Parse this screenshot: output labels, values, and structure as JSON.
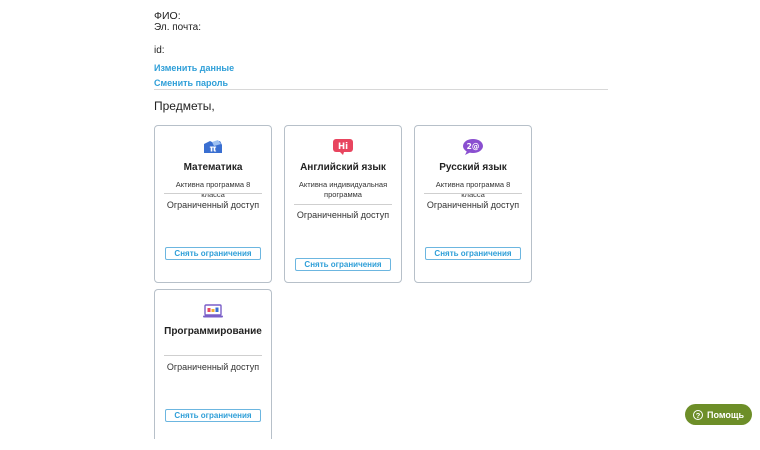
{
  "profile": {
    "fio_label": "ФИО:",
    "email_label": "Эл. почта:",
    "id_label": "id:",
    "edit_link": "Изменить данные",
    "password_link": "Сменить пароль"
  },
  "subjects_title": "Предметы,",
  "cards": [
    {
      "name": "Математика",
      "desc": "Активна программа 8 класса",
      "status": "Ограниченный доступ",
      "button": "Снять ограничения",
      "icon": "pi-math-icon"
    },
    {
      "name": "Английский язык",
      "desc": "Активна индивидуальная программа",
      "status": "Ограниченный доступ",
      "button": "Снять ограничения",
      "icon": "hi-speech-bubble-icon"
    },
    {
      "name": "Русский язык",
      "desc": "Активна программа 8 класса",
      "status": "Ограниченный доступ",
      "button": "Снять ограничения",
      "icon": "speech-bubble-icon"
    },
    {
      "name": "Программирование",
      "desc": "",
      "status": "Ограниченный доступ",
      "button": "Снять ограничения",
      "icon": "laptop-icon"
    }
  ],
  "help_button": {
    "label": "Помощь",
    "icon": "question-circle-icon"
  },
  "colors": {
    "link": "#2f9fd8",
    "help_bg": "#6d8e28",
    "card_border": "#b7c0c9"
  }
}
